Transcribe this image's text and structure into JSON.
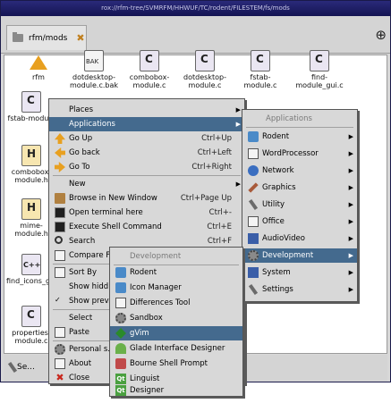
{
  "window": {
    "title": "rox://rfm-tree/SVMRFM/HHWUF/TC/rodent/FILESTEM/fs/mods",
    "tab_label": "rfm/mods",
    "tab_close": "✖",
    "new_tab": "⊕"
  },
  "files": [
    {
      "label": "rfm",
      "icon": "up"
    },
    {
      "label": "dotdesktop-module.c.bak",
      "icon": "bak"
    },
    {
      "label": "combobox-module.c",
      "icon": "c"
    },
    {
      "label": "dotdesktop-module.c",
      "icon": "c"
    },
    {
      "label": "fstab-module.c",
      "icon": "c"
    },
    {
      "label": "find-module_gui.c",
      "icon": "c"
    },
    {
      "label": "fstab-module",
      "icon": "c"
    },
    {
      "label": "combobox-module.h",
      "icon": "h"
    },
    {
      "label": "mime-module.h",
      "icon": "h"
    },
    {
      "label": "find_icons_glob.c",
      "icon": "cpp"
    },
    {
      "label": "properties-module.c",
      "icon": "c"
    }
  ],
  "statusbar": {
    "label": "Se..."
  },
  "context_menu": {
    "items": [
      {
        "label": "Places",
        "submenu": true
      },
      {
        "label": "Applications",
        "submenu": true,
        "highlighted": true
      },
      {
        "label": "Go Up",
        "accel": "Ctrl+Up",
        "icon": "up"
      },
      {
        "label": "Go back",
        "accel": "Ctrl+Left",
        "icon": "left"
      },
      {
        "label": "Go To",
        "accel": "Ctrl+Right",
        "icon": "right"
      },
      {
        "label": "New",
        "submenu": true
      },
      {
        "label": "Browse in New Window",
        "accel": "Ctrl+Page Up",
        "icon": "folder"
      },
      {
        "label": "Open terminal here",
        "accel": "Ctrl+-",
        "icon": "term"
      },
      {
        "label": "Execute Shell Command",
        "accel": "Ctrl+E",
        "icon": "term"
      },
      {
        "label": "Search",
        "accel": "Ctrl+F",
        "icon": "mag"
      },
      {
        "label": "Compare F...",
        "icon": "doc"
      },
      {
        "label": "Sort By",
        "icon": "doc"
      },
      {
        "label": "Show hidd..."
      },
      {
        "label": "Show prev..."
      },
      {
        "label": "Select"
      },
      {
        "label": "Paste",
        "icon": "doc"
      },
      {
        "label": "Personal s...",
        "icon": "gear"
      },
      {
        "label": "About",
        "icon": "doc"
      },
      {
        "label": "Close",
        "icon": "x"
      }
    ]
  },
  "applications_menu": {
    "header": "Applications",
    "items": [
      {
        "label": "Rodent",
        "icon": "gb"
      },
      {
        "label": "WordProcessor",
        "icon": "doc"
      },
      {
        "label": "Network",
        "icon": "globe"
      },
      {
        "label": "Graphics",
        "icon": "brush"
      },
      {
        "label": "Utility",
        "icon": "wrench"
      },
      {
        "label": "Office",
        "icon": "doc"
      },
      {
        "label": "AudioVideo",
        "icon": "blue"
      },
      {
        "label": "Development",
        "icon": "gear",
        "highlighted": true
      },
      {
        "label": "System",
        "icon": "blue"
      },
      {
        "label": "Settings",
        "icon": "wrench"
      }
    ]
  },
  "development_menu": {
    "header": "Development",
    "items": [
      {
        "label": "Rodent",
        "icon": "gb"
      },
      {
        "label": "Icon Manager",
        "icon": "gb"
      },
      {
        "label": "Differences Tool",
        "icon": "doc"
      },
      {
        "label": "Sandbox",
        "icon": "gear"
      },
      {
        "label": "gVim",
        "icon": "vim",
        "highlighted": true
      },
      {
        "label": "Glade Interface Designer",
        "icon": "glade"
      },
      {
        "label": "Bourne Shell Prompt",
        "icon": "bs"
      },
      {
        "label": "Linguist",
        "icon": "qt"
      },
      {
        "label": "Designer",
        "icon": "qt"
      }
    ]
  },
  "colors": {
    "highlight": "#446a8e",
    "menu_bg": "#d8d8d8",
    "title_bg": "#141452"
  }
}
